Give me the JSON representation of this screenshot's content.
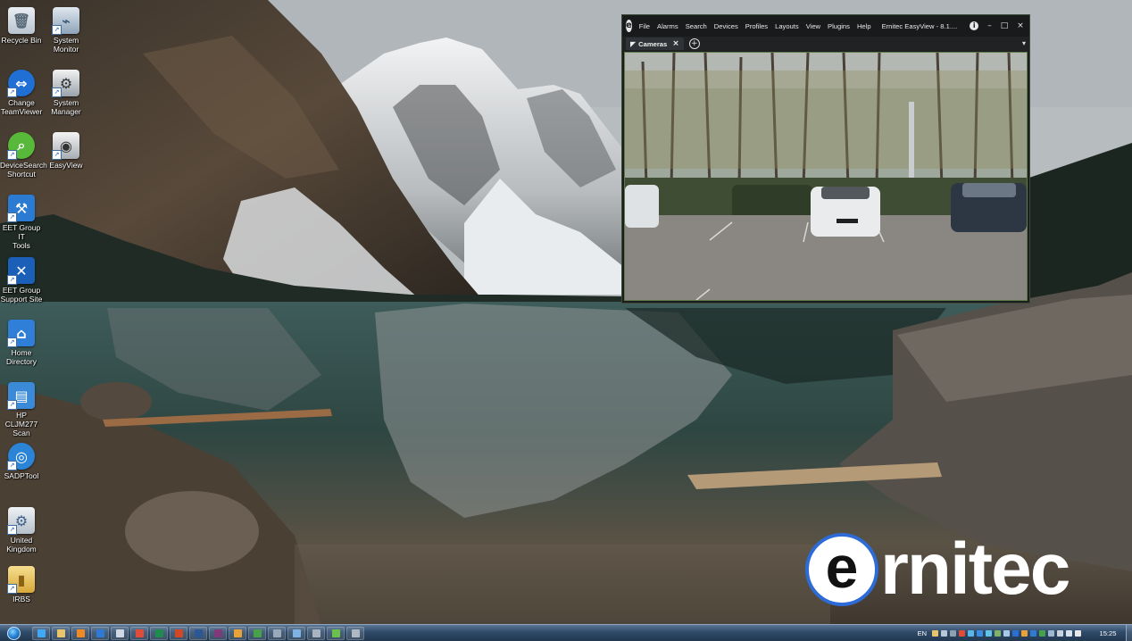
{
  "desktop": {
    "icons": [
      {
        "label": "Recycle Bin",
        "icon": "recycle-bin-icon"
      },
      {
        "label": "System\nMonitor",
        "icon": "system-monitor-icon"
      },
      {
        "label": "Change\nTeamViewer",
        "icon": "teamviewer-icon"
      },
      {
        "label": "System\nManager",
        "icon": "system-manager-icon"
      },
      {
        "label": "DeviceSearch\nShortcut",
        "icon": "device-search-icon"
      },
      {
        "label": "EasyView",
        "icon": "easyview-camera-icon"
      },
      {
        "label": "EET Group IT\nTools",
        "icon": "it-tools-icon"
      },
      {
        "label": "EET Group\nSupport Site",
        "icon": "support-site-icon"
      },
      {
        "label": "Home\nDirectory",
        "icon": "home-directory-icon"
      },
      {
        "label": "HP CLJM277\nScan",
        "icon": "scanner-icon"
      },
      {
        "label": "SADPTool",
        "icon": "sadp-tool-icon"
      },
      {
        "label": "United\nKingdom",
        "icon": "united-kingdom-icon"
      },
      {
        "label": "IRBS",
        "icon": "folder-icon"
      }
    ]
  },
  "app_window": {
    "logo": "e",
    "menu": [
      "File",
      "Alarms",
      "Search",
      "Devices",
      "Profiles",
      "Layouts",
      "View",
      "Plugins",
      "Help"
    ],
    "title": "Ernitec EasyView - 8.1....",
    "controls": {
      "info": "i",
      "minimize": "–",
      "maximize": "□",
      "close": "×"
    },
    "tab": {
      "label": "Cameras",
      "close": "×"
    },
    "add_tab": "+",
    "tab_menu": "▾"
  },
  "brand": {
    "first_letter": "e",
    "rest": "rnitec",
    "ring_color": "#2d6bd6"
  },
  "taskbar": {
    "start": "start-orb-icon",
    "apps": [
      {
        "icon": "internet-explorer-icon",
        "color": "#3fa9f5"
      },
      {
        "icon": "file-explorer-icon",
        "color": "#e8c56a"
      },
      {
        "icon": "media-player-icon",
        "color": "#f08a24"
      },
      {
        "icon": "outlook-icon",
        "color": "#2f7bd4"
      },
      {
        "icon": "taskbar-app-icon",
        "color": "#cfd8e3"
      },
      {
        "icon": "chrome-icon",
        "color": "#e04b3a"
      },
      {
        "icon": "excel-icon",
        "color": "#1f8c4e"
      },
      {
        "icon": "powerpoint-icon",
        "color": "#d24726"
      },
      {
        "icon": "word-icon",
        "color": "#2b5797"
      },
      {
        "icon": "onenote-icon",
        "color": "#80397b"
      },
      {
        "icon": "paint-icon",
        "color": "#e8a23a"
      },
      {
        "icon": "project-icon",
        "color": "#47a04a"
      },
      {
        "icon": "folder-app-icon",
        "color": "#9aa9b8"
      },
      {
        "icon": "remote-desktop-icon",
        "color": "#7fb2e5"
      },
      {
        "icon": "tools-icon",
        "color": "#a9b4c0"
      },
      {
        "icon": "device-search-icon",
        "color": "#6ac04a"
      },
      {
        "icon": "easyview-icon",
        "color": "#b0b8c0"
      }
    ],
    "tray": {
      "language": "EN",
      "icons": [
        {
          "icon": "tray-mail-icon",
          "color": "#e8c56a"
        },
        {
          "icon": "tray-network-icon",
          "color": "#b7c7d8"
        },
        {
          "icon": "tray-sync-icon",
          "color": "#8fa0b3"
        },
        {
          "icon": "tray-alert-icon",
          "color": "#e04b3a"
        },
        {
          "icon": "tray-app-icon",
          "color": "#58b6e8"
        },
        {
          "icon": "tray-teamviewer-icon",
          "color": "#3a8de0"
        },
        {
          "icon": "tray-chat-icon",
          "color": "#5fc3e8"
        },
        {
          "icon": "tray-shield-icon",
          "color": "#7fb36a"
        },
        {
          "icon": "tray-update-icon",
          "color": "#a9c7e8"
        },
        {
          "icon": "tray-bluetooth-icon",
          "color": "#2b6fd4"
        },
        {
          "icon": "tray-box-icon",
          "color": "#e8a23a"
        },
        {
          "icon": "tray-office-icon",
          "color": "#2f7bd4"
        },
        {
          "icon": "tray-leaf-icon",
          "color": "#47a04a"
        },
        {
          "icon": "tray-device-icon",
          "color": "#9fb6cf"
        },
        {
          "icon": "tray-monitor-icon",
          "color": "#c9d3dd"
        },
        {
          "icon": "tray-volume-icon",
          "color": "#d9e2ec"
        },
        {
          "icon": "tray-flag-icon",
          "color": "#e8e8e8"
        }
      ],
      "clock": "15:25"
    }
  }
}
